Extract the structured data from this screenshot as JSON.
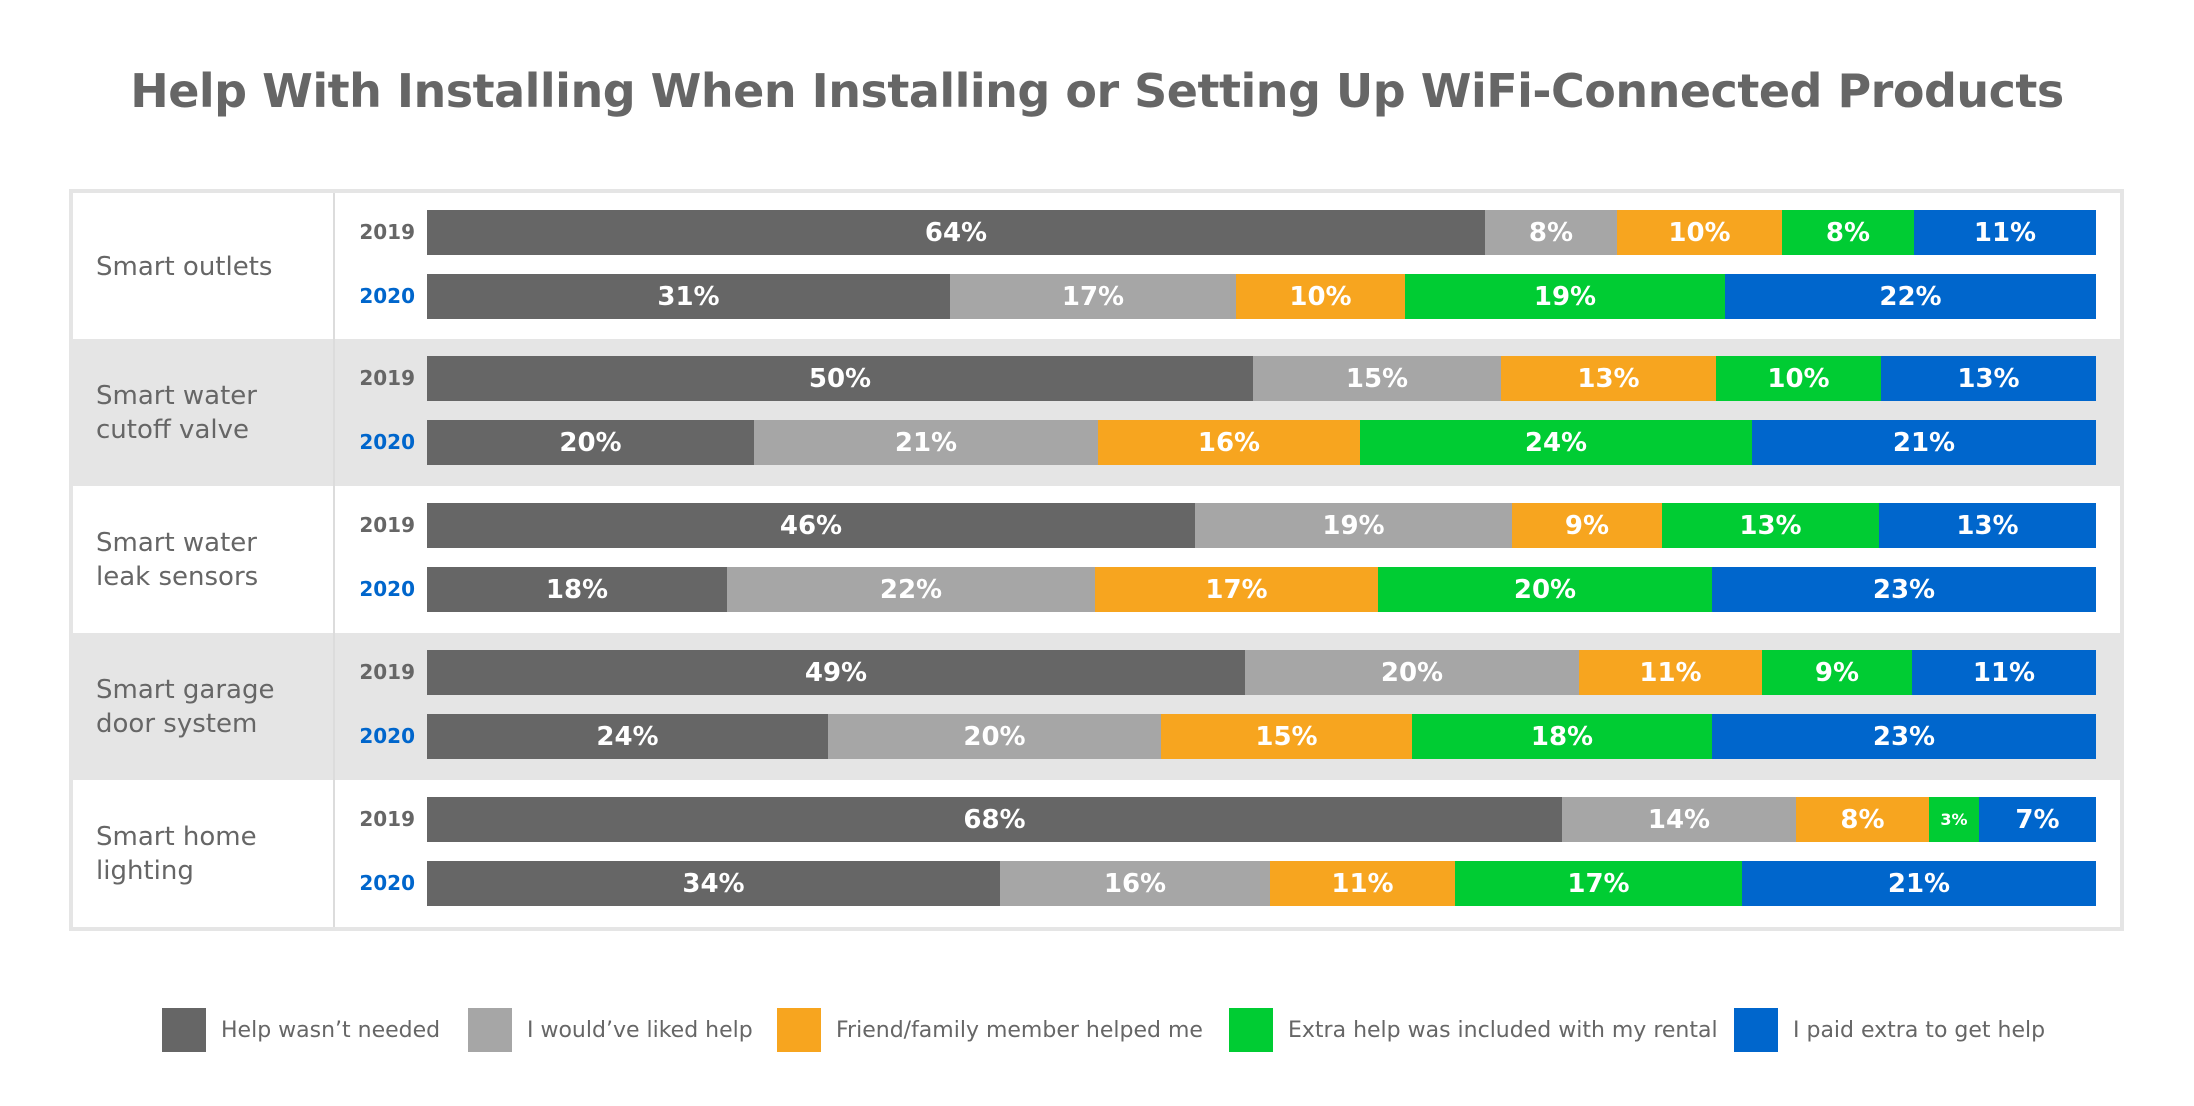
{
  "chart_data": {
    "type": "bar",
    "orientation": "horizontal",
    "stacked": true,
    "title": "Help With Installing When Installing or Setting Up WiFi-Connected Products",
    "xlabel": "",
    "ylabel": "",
    "unit": "%",
    "series_names": [
      "Help wasn’t needed",
      "I would’ve liked help",
      "Friend/family member helped me",
      "Extra help was included with my rental",
      "I paid extra to get help"
    ],
    "series_colors": [
      "#666666",
      "#a6a6a6",
      "#f7a51f",
      "#00cc33",
      "#0066cc"
    ],
    "year_colors": {
      "2019": "#666666",
      "2020": "#0066cc"
    },
    "legend_position": "bottom",
    "categories": [
      {
        "label": "Smart outlets",
        "bars": [
          {
            "year": "2019",
            "values": [
              64,
              8,
              10,
              8,
              11
            ]
          },
          {
            "year": "2020",
            "values": [
              31,
              17,
              10,
              19,
              22
            ]
          }
        ]
      },
      {
        "label": "Smart water\ncutoff valve",
        "bars": [
          {
            "year": "2019",
            "values": [
              50,
              15,
              13,
              10,
              13
            ]
          },
          {
            "year": "2020",
            "values": [
              20,
              21,
              16,
              24,
              21
            ]
          }
        ]
      },
      {
        "label": "Smart water\nleak sensors",
        "bars": [
          {
            "year": "2019",
            "values": [
              46,
              19,
              9,
              13,
              13
            ]
          },
          {
            "year": "2020",
            "values": [
              18,
              22,
              17,
              20,
              23
            ]
          }
        ]
      },
      {
        "label": "Smart garage\ndoor system",
        "bars": [
          {
            "year": "2019",
            "values": [
              49,
              20,
              11,
              9,
              11
            ]
          },
          {
            "year": "2020",
            "values": [
              24,
              20,
              15,
              18,
              23
            ]
          }
        ]
      },
      {
        "label": "Smart home\nlighting",
        "bars": [
          {
            "year": "2019",
            "values": [
              68,
              14,
              8,
              3,
              7
            ]
          },
          {
            "year": "2020",
            "values": [
              34,
              16,
              11,
              17,
              21
            ]
          }
        ]
      }
    ]
  }
}
